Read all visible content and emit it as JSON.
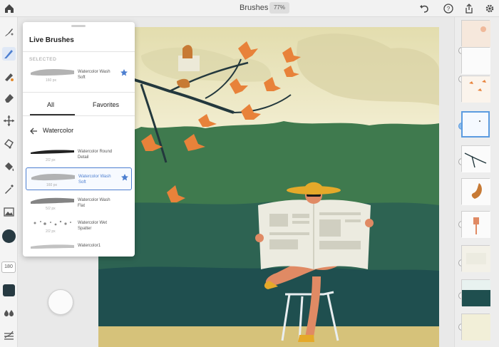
{
  "topbar": {
    "title": "Brushes",
    "zoom": "77%",
    "icons": [
      "home-icon",
      "undo-icon",
      "help-icon",
      "share-icon",
      "settings-icon"
    ]
  },
  "left_toolbar": {
    "tools": [
      "paint-brush-icon",
      "brush-selected-icon",
      "fill-brush-icon",
      "eraser-icon",
      "move-icon",
      "lasso-icon",
      "paint-bucket-icon",
      "eyedropper-icon",
      "image-icon"
    ],
    "size_value": "180",
    "color": "#273a42"
  },
  "brush_panel": {
    "title": "Live Brushes",
    "selected_label": "SELECTED",
    "selected_brush": {
      "name": "Watercolor Wash Soft",
      "size": "160 px"
    },
    "tabs": [
      "All",
      "Favorites"
    ],
    "category": "Watercolor",
    "brushes": [
      {
        "name": "Watercolor Round Detail",
        "size": "2/2 px",
        "selected": false
      },
      {
        "name": "Watercolor Wash Soft",
        "size": "160 px",
        "selected": true
      },
      {
        "name": "Watercolor Wash Flat",
        "size": "5/2 px",
        "selected": false
      },
      {
        "name": "Watercolor Wet Spatter",
        "size": "2/2 px",
        "selected": false
      },
      {
        "name": "Watercolor1",
        "size": "",
        "selected": false
      }
    ],
    "accent": "#4d7fd0"
  },
  "layers": {
    "count": 11,
    "active_index": 3
  },
  "colors": {
    "sky": "#ece7c2",
    "hedge": "#3f7a4e",
    "hedge_dark": "#1f4f4f",
    "leaf": "#e8823a",
    "hat": "#e5a92a"
  }
}
